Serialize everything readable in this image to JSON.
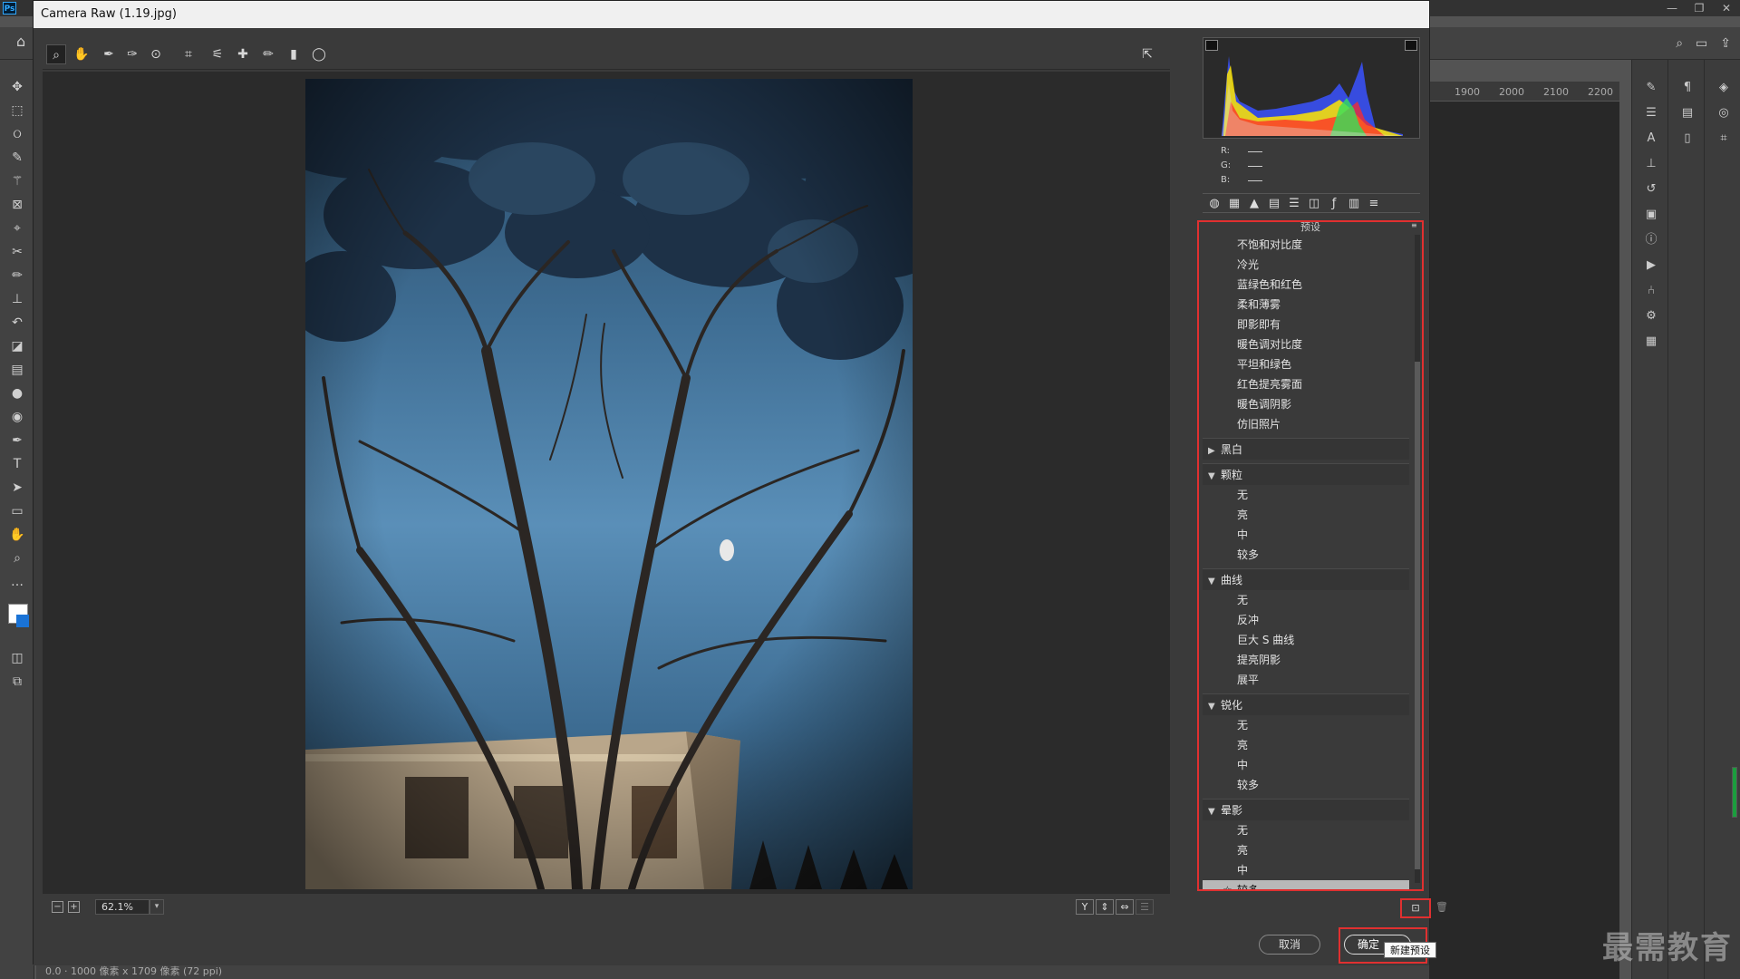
{
  "ps": {
    "logo": "Ps",
    "window_controls": [
      "—",
      "❐",
      "✕"
    ],
    "ruler": [
      "1900",
      "2000",
      "2100",
      "2200"
    ],
    "status": "0.0 · 1000 像素 x 1709 像素 (72 ppi)"
  },
  "dialog": {
    "title": "Camera Raw (1.19.jpg)",
    "zoom": "62.1%",
    "view_buttons": [
      "Y",
      "⇕",
      "⇔"
    ],
    "cancel_label": "取消",
    "ok_label": "确定",
    "tooltip": "新建预设"
  },
  "histogram": {
    "rgb_labels": [
      "R:",
      "G:",
      "B:"
    ]
  },
  "presets": {
    "title": "预设",
    "top_items": [
      "不饱和对比度",
      "冷光",
      "蓝绿色和红色",
      "柔和薄雾",
      "即影即有",
      "暖色调对比度",
      "平坦和绿色",
      "红色提亮雾面",
      "暖色调阴影",
      "仿旧照片"
    ],
    "groups": [
      {
        "name": "黑白",
        "expanded": false,
        "items": []
      },
      {
        "name": "颗粒",
        "expanded": true,
        "items": [
          "无",
          "亮",
          "中",
          "较多"
        ]
      },
      {
        "name": "曲线",
        "expanded": true,
        "items": [
          "无",
          "反冲",
          "巨大 S 曲线",
          "提亮阴影",
          "展平"
        ]
      },
      {
        "name": "锐化",
        "expanded": true,
        "items": [
          "无",
          "亮",
          "中",
          "较多"
        ]
      },
      {
        "name": "晕影",
        "expanded": true,
        "items": [
          "无",
          "亮",
          "中",
          "较多"
        ]
      }
    ],
    "selected": "较多"
  },
  "watermark": "最需教育",
  "colors": {
    "highlight": "#e03030",
    "sky": "#5a8fb8"
  }
}
